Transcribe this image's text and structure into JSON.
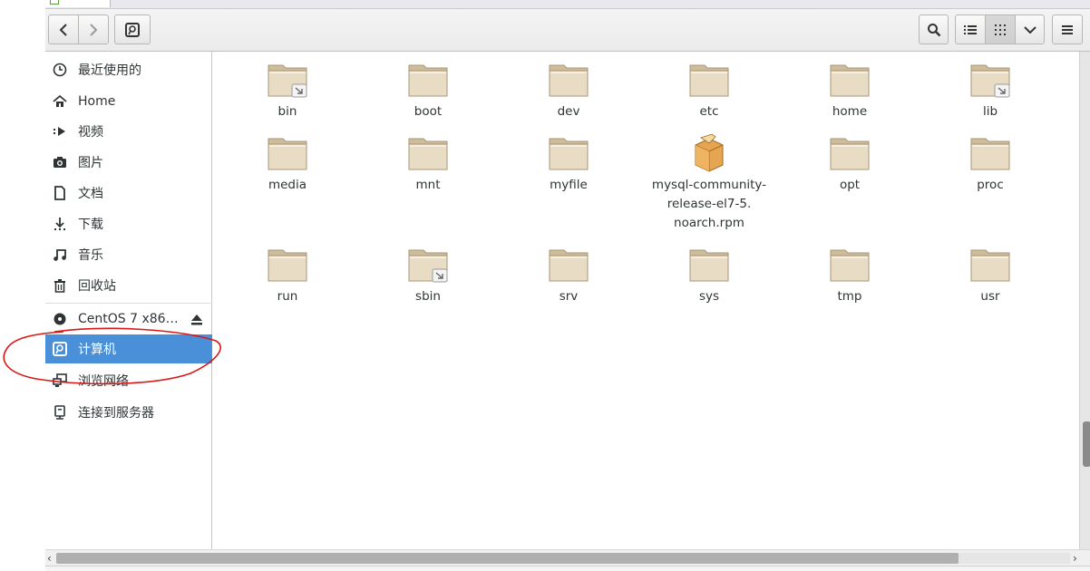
{
  "sidebar": {
    "items": [
      {
        "label": "最近使用的",
        "icon": "recent-icon"
      },
      {
        "label": "Home",
        "icon": "home-icon"
      },
      {
        "label": "视频",
        "icon": "video-icon"
      },
      {
        "label": "图片",
        "icon": "camera-icon"
      },
      {
        "label": "文档",
        "icon": "document-icon"
      },
      {
        "label": "下载",
        "icon": "download-icon"
      },
      {
        "label": "音乐",
        "icon": "music-icon"
      },
      {
        "label": "回收站",
        "icon": "trash-icon"
      },
      {
        "label": "CentOS 7 x86…",
        "icon": "disc-icon"
      },
      {
        "label": "计算机",
        "icon": "computer-icon",
        "selected": true
      },
      {
        "label": "浏览网络",
        "icon": "network-icon"
      },
      {
        "label": "连接到服务器",
        "icon": "server-icon"
      }
    ]
  },
  "files": [
    {
      "name": "bin",
      "type": "folder-link"
    },
    {
      "name": "boot",
      "type": "folder"
    },
    {
      "name": "dev",
      "type": "folder"
    },
    {
      "name": "etc",
      "type": "folder"
    },
    {
      "name": "home",
      "type": "folder"
    },
    {
      "name": "lib",
      "type": "folder-link"
    },
    {
      "name": "media",
      "type": "folder"
    },
    {
      "name": "mnt",
      "type": "folder"
    },
    {
      "name": "myfile",
      "type": "folder"
    },
    {
      "name_lines": [
        "mysql-community-",
        "release-el7-5.",
        "noarch.rpm"
      ],
      "type": "package"
    },
    {
      "name": "opt",
      "type": "folder"
    },
    {
      "name": "proc",
      "type": "folder"
    },
    {
      "name": "run",
      "type": "folder"
    },
    {
      "name": "sbin",
      "type": "folder-link"
    },
    {
      "name": "srv",
      "type": "folder"
    },
    {
      "name": "sys",
      "type": "folder"
    },
    {
      "name": "tmp",
      "type": "folder"
    },
    {
      "name": "usr",
      "type": "folder"
    }
  ],
  "colors": {
    "selection": "#4a90d9",
    "folder": "#e8dcc4",
    "annotation": "#d81818"
  }
}
